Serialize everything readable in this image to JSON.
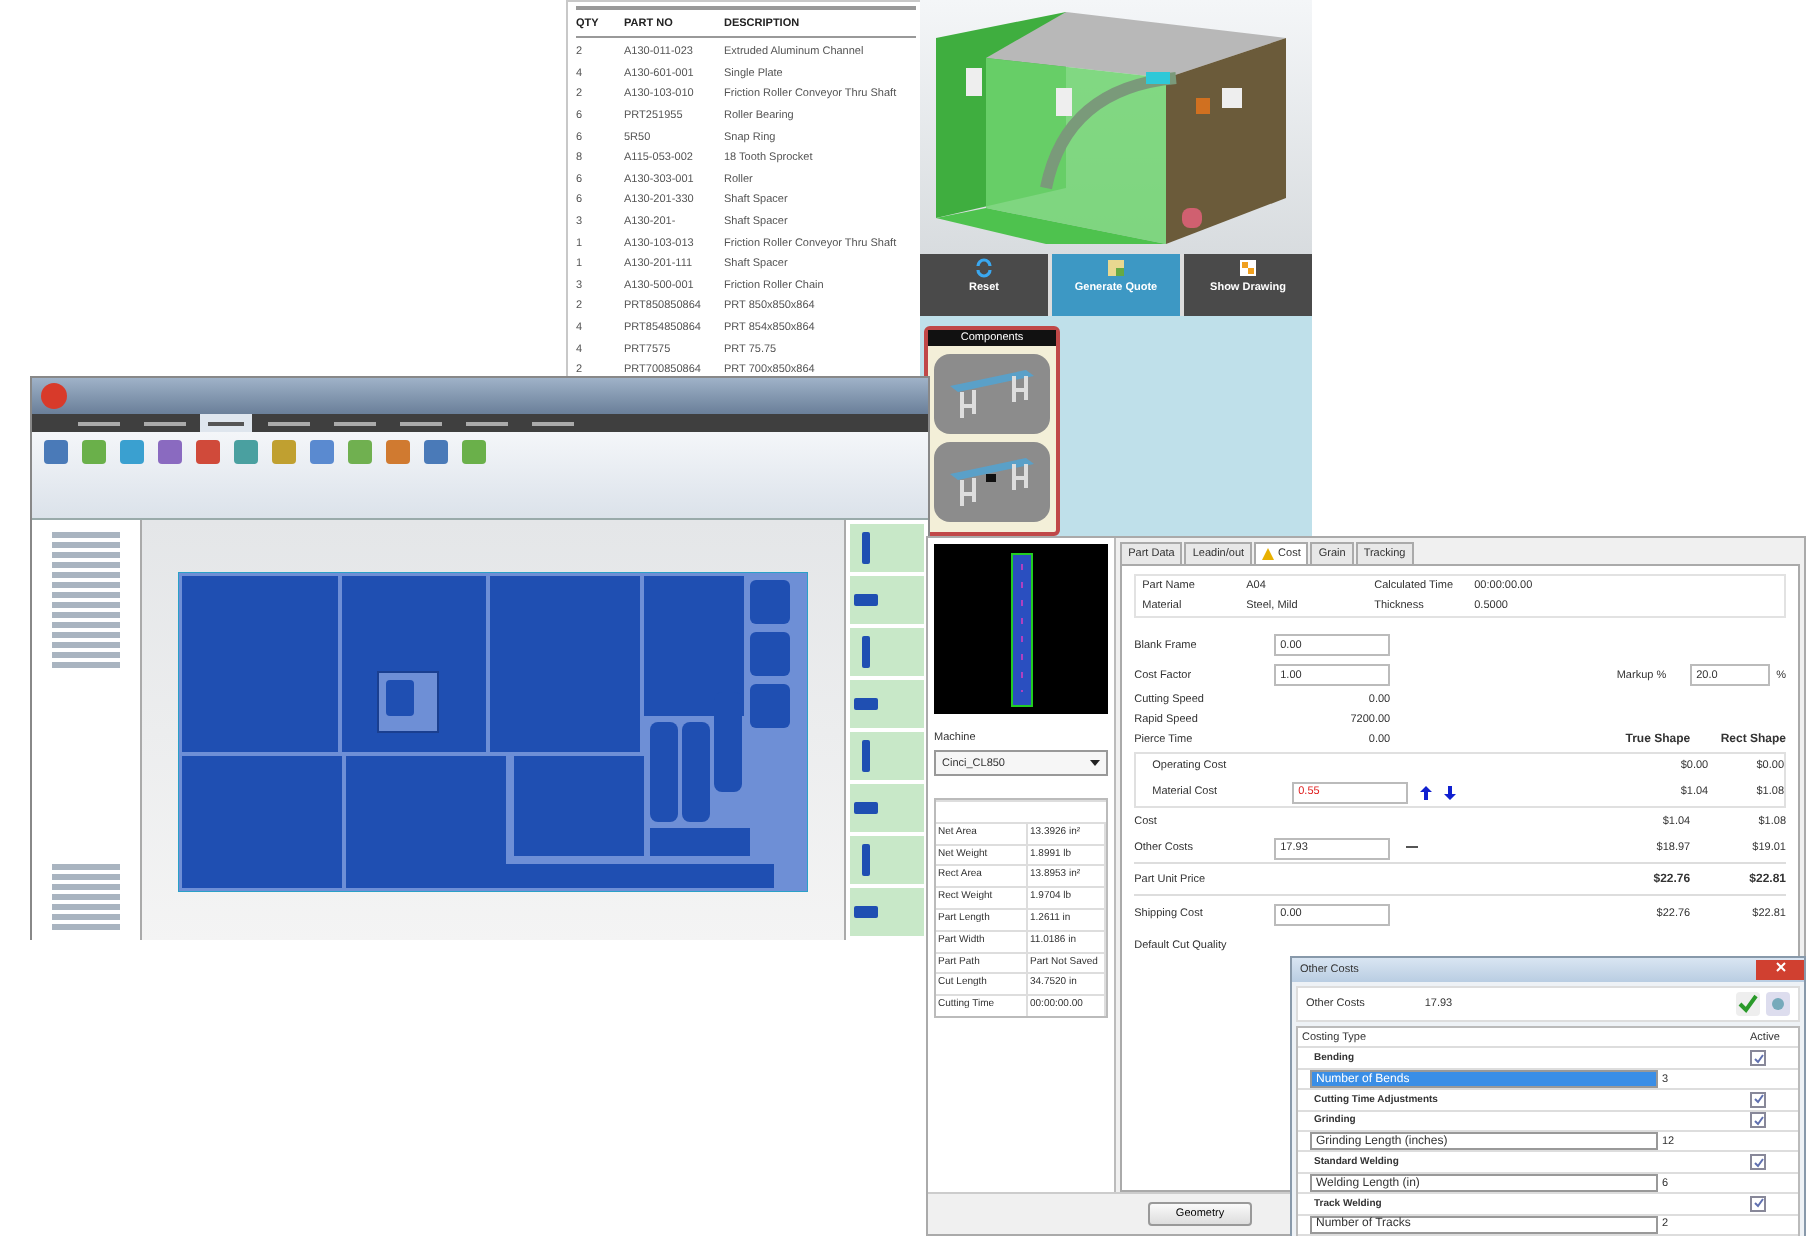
{
  "parts_list": {
    "columns": [
      "QTY",
      "PART NO",
      "DESCRIPTION"
    ],
    "rows": [
      [
        "2",
        "A130-011-023",
        "Extruded Aluminum Channel"
      ],
      [
        "4",
        "A130-601-001",
        "Single Plate"
      ],
      [
        "2",
        "A130-103-010",
        "Friction Roller Conveyor Thru Shaft"
      ],
      [
        "6",
        "PRT251955",
        "Roller Bearing"
      ],
      [
        "6",
        "5R50",
        "Snap Ring"
      ],
      [
        "8",
        "A115-053-002",
        "18 Tooth Sprocket"
      ],
      [
        "6",
        "A130-303-001",
        "Roller"
      ],
      [
        "6",
        "A130-201-330",
        "Shaft Spacer"
      ],
      [
        "3",
        "A130-201-",
        "Shaft Spacer"
      ],
      [
        "1",
        "A130-103-013",
        "Friction Roller Conveyor Thru Shaft"
      ],
      [
        "1",
        "A130-201-111",
        "Shaft Spacer"
      ],
      [
        "3",
        "A130-500-001",
        "Friction Roller Chain"
      ],
      [
        "2",
        "PRT850850864",
        "PRT 850x850x864"
      ],
      [
        "4",
        "PRT854850864",
        "PRT 854x850x864"
      ],
      [
        "4",
        "PRT7575",
        "PRT 75.75"
      ],
      [
        "2",
        "PRT700850864",
        "PRT 700x850x864"
      ]
    ]
  },
  "model_viewer": {
    "buttons": [
      {
        "label": "Reset",
        "kind": "reset",
        "selected": false
      },
      {
        "label": "Generate Quote",
        "kind": "quote",
        "selected": true
      },
      {
        "label": "Show Drawing",
        "kind": "drawing",
        "selected": false
      }
    ],
    "components": {
      "title": "Components",
      "items": [
        {
          "kind": "conveyor"
        },
        {
          "kind": "conveyor_motor"
        }
      ]
    }
  },
  "nesting_window": {
    "ribbon_tabs": [
      {
        "selected": false
      },
      {
        "selected": false
      },
      {
        "selected": true
      },
      {
        "selected": false
      },
      {
        "selected": false
      },
      {
        "selected": false
      },
      {
        "selected": false
      },
      {
        "selected": false
      }
    ]
  },
  "cost_window": {
    "machine_label": "Machine",
    "machine": "Cinci_CL850",
    "properties": [
      [
        "Net Area",
        "13.3926 in²"
      ],
      [
        "Net Weight",
        "1.8991 lb"
      ],
      [
        "Rect Area",
        "13.8953 in²"
      ],
      [
        "Rect Weight",
        "1.9704 lb"
      ],
      [
        "Part Length",
        "1.2611 in"
      ],
      [
        "Part Width",
        "11.0186 in"
      ],
      [
        "Part Path",
        "Part Not Saved"
      ],
      [
        "Cut Length",
        "34.7520 in"
      ],
      [
        "Cutting Time",
        "00:00:00.00"
      ]
    ],
    "tabs": [
      {
        "label": "Part Data",
        "selected": false,
        "warning": false
      },
      {
        "label": "Leadin/out",
        "selected": false,
        "warning": false
      },
      {
        "label": "Cost",
        "selected": true,
        "warning": true
      },
      {
        "label": "Grain",
        "selected": false,
        "warning": false
      },
      {
        "label": "Tracking",
        "selected": false,
        "warning": false
      }
    ],
    "info": [
      [
        "Part Name",
        "A04",
        "Calculated Time",
        "00:00:00.00"
      ],
      [
        "Material",
        "Steel, Mild",
        "Thickness",
        "0.5000"
      ]
    ],
    "blank_frame": {
      "label": "Blank Frame",
      "value": "0.00"
    },
    "cost_factor": {
      "label": "Cost Factor",
      "value": "1.00"
    },
    "markup": {
      "label": "Markup %",
      "value": "20.0",
      "unit": "%"
    },
    "speeds": [
      [
        "Cutting Speed",
        "0.00"
      ],
      [
        "Rapid Speed",
        "7200.00"
      ],
      [
        "Pierce Time",
        "0.00"
      ]
    ],
    "columns": [
      "True Shape",
      "Rect Shape"
    ],
    "operating_cost": {
      "label": "Operating Cost",
      "true": "$0.00",
      "rect": "$0.00"
    },
    "material_cost": {
      "label": "Material Cost",
      "value": "0.55",
      "true": "$1.04",
      "rect": "$1.08"
    },
    "cost": {
      "label": "Cost",
      "true": "$1.04",
      "rect": "$1.08"
    },
    "other_costs": {
      "label": "Other Costs",
      "value": "17.93",
      "true": "$18.97",
      "rect": "$19.01"
    },
    "unit_price": {
      "label": "Part Unit Price",
      "true": "$22.76",
      "rect": "$22.81"
    },
    "shipping": {
      "label": "Shipping Cost",
      "value": "0.00",
      "true": "$22.76",
      "rect": "$22.81"
    },
    "cut_quality_label": "Default Cut Quality",
    "geometry_button": "Geometry"
  },
  "other_costs_dialog": {
    "title": "Other Costs",
    "summary_label": "Other Costs",
    "summary_value": "17.93",
    "columns": [
      "Costing Type",
      "Active"
    ],
    "rows": [
      {
        "kind": "group",
        "label": "Bending",
        "checked": true
      },
      {
        "kind": "param",
        "label": "Number of Bends",
        "value": "3",
        "selected": true
      },
      {
        "kind": "group",
        "label": "Cutting Time Adjustments",
        "checked": true
      },
      {
        "kind": "group",
        "label": "Grinding",
        "checked": true
      },
      {
        "kind": "param",
        "label": "Grinding Length (inches)",
        "value": "12",
        "selected": false
      },
      {
        "kind": "group",
        "label": "Standard Welding",
        "checked": true
      },
      {
        "kind": "param",
        "label": "Welding Length (in)",
        "value": "6",
        "selected": false
      },
      {
        "kind": "group",
        "label": "Track Welding",
        "checked": true
      },
      {
        "kind": "param",
        "label": "Number of Tracks",
        "value": "2",
        "selected": false
      }
    ]
  }
}
